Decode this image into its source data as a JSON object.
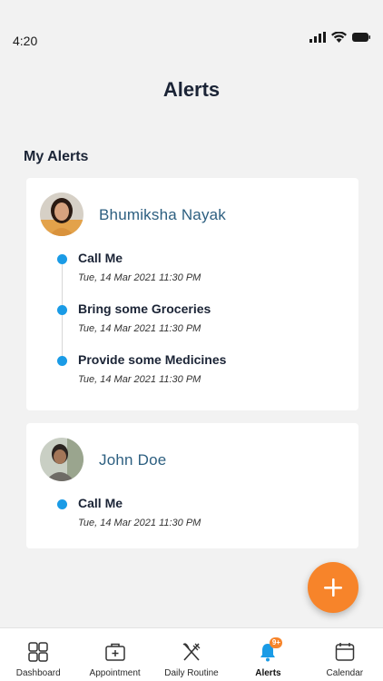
{
  "status_bar": {
    "time": "4:20"
  },
  "header": {
    "title": "Alerts"
  },
  "section": {
    "title": "My Alerts"
  },
  "cards": [
    {
      "name": "Bhumiksha Nayak",
      "alerts": [
        {
          "title": "Call Me",
          "time": "Tue, 14 Mar 2021 11:30 PM"
        },
        {
          "title": "Bring some Groceries",
          "time": "Tue, 14 Mar 2021 11:30 PM"
        },
        {
          "title": "Provide some Medicines",
          "time": "Tue, 14 Mar 2021 11:30 PM"
        }
      ]
    },
    {
      "name": "John Doe",
      "alerts": [
        {
          "title": "Call Me",
          "time": "Tue, 14 Mar 2021 11:30 PM"
        }
      ]
    }
  ],
  "fab": {
    "icon": "plus-icon",
    "color": "#f7842a"
  },
  "accent": {
    "timeline_dot": "#1a9be6",
    "name_color": "#2d5f80"
  },
  "bottom_nav": {
    "items": [
      {
        "label": "Dashboard",
        "icon": "grid-icon"
      },
      {
        "label": "Appointment",
        "icon": "medical-bag-icon"
      },
      {
        "label": "Daily Routine",
        "icon": "cutlery-icon"
      },
      {
        "label": "Alerts",
        "icon": "bell-icon",
        "badge": "9+",
        "active": true
      },
      {
        "label": "Calendar",
        "icon": "calendar-icon"
      }
    ]
  }
}
